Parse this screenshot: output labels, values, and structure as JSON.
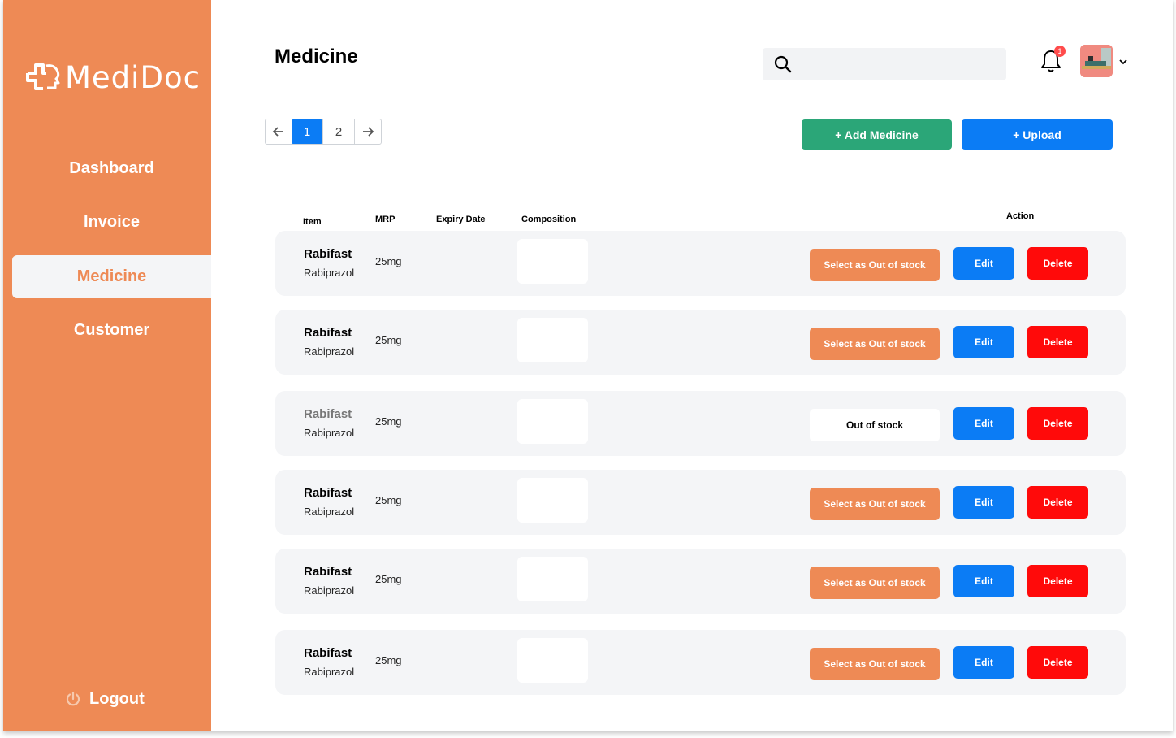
{
  "brand": {
    "name": "MediDoc"
  },
  "colors": {
    "sidebar": "#ee8a55",
    "primary": "#0b7cf5",
    "success": "#2ba678",
    "danger": "#ff0a0a"
  },
  "sidebar": {
    "items": [
      {
        "label": "Dashboard",
        "active": false
      },
      {
        "label": "Invoice",
        "active": false
      },
      {
        "label": "Medicine",
        "active": true
      },
      {
        "label": "Customer",
        "active": false
      }
    ],
    "logout_label": "Logout"
  },
  "header": {
    "title": "Medicine",
    "search_placeholder": "",
    "notification_count": "1"
  },
  "pagination": {
    "pages": [
      "1",
      "2"
    ],
    "current": "1"
  },
  "actions": {
    "add_label": "+ Add Medicine",
    "upload_label": "+ Upload"
  },
  "table": {
    "columns": {
      "item": "Item",
      "mrp": "MRP",
      "expiry": "Expiry Date",
      "composition": "Composition",
      "action": "Action"
    },
    "rows": [
      {
        "name": "Rabifast",
        "generic": "Rabiprazol",
        "mrp": "25mg",
        "stock_label": "Select as Out of stock",
        "out_of_stock": false,
        "edit": "Edit",
        "delete": "Delete"
      },
      {
        "name": "Rabifast",
        "generic": "Rabiprazol",
        "mrp": "25mg",
        "stock_label": "Select as Out of stock",
        "out_of_stock": false,
        "edit": "Edit",
        "delete": "Delete"
      },
      {
        "name": "Rabifast",
        "generic": "Rabiprazol",
        "mrp": "25mg",
        "stock_label": "Out of stock",
        "out_of_stock": true,
        "edit": "Edit",
        "delete": "Delete"
      },
      {
        "name": "Rabifast",
        "generic": "Rabiprazol",
        "mrp": "25mg",
        "stock_label": "Select as Out of stock",
        "out_of_stock": false,
        "edit": "Edit",
        "delete": "Delete"
      },
      {
        "name": "Rabifast",
        "generic": "Rabiprazol",
        "mrp": "25mg",
        "stock_label": "Select as Out of stock",
        "out_of_stock": false,
        "edit": "Edit",
        "delete": "Delete"
      },
      {
        "name": "Rabifast",
        "generic": "Rabiprazol",
        "mrp": "25mg",
        "stock_label": "Select as Out of stock",
        "out_of_stock": false,
        "edit": "Edit",
        "delete": "Delete"
      }
    ]
  }
}
